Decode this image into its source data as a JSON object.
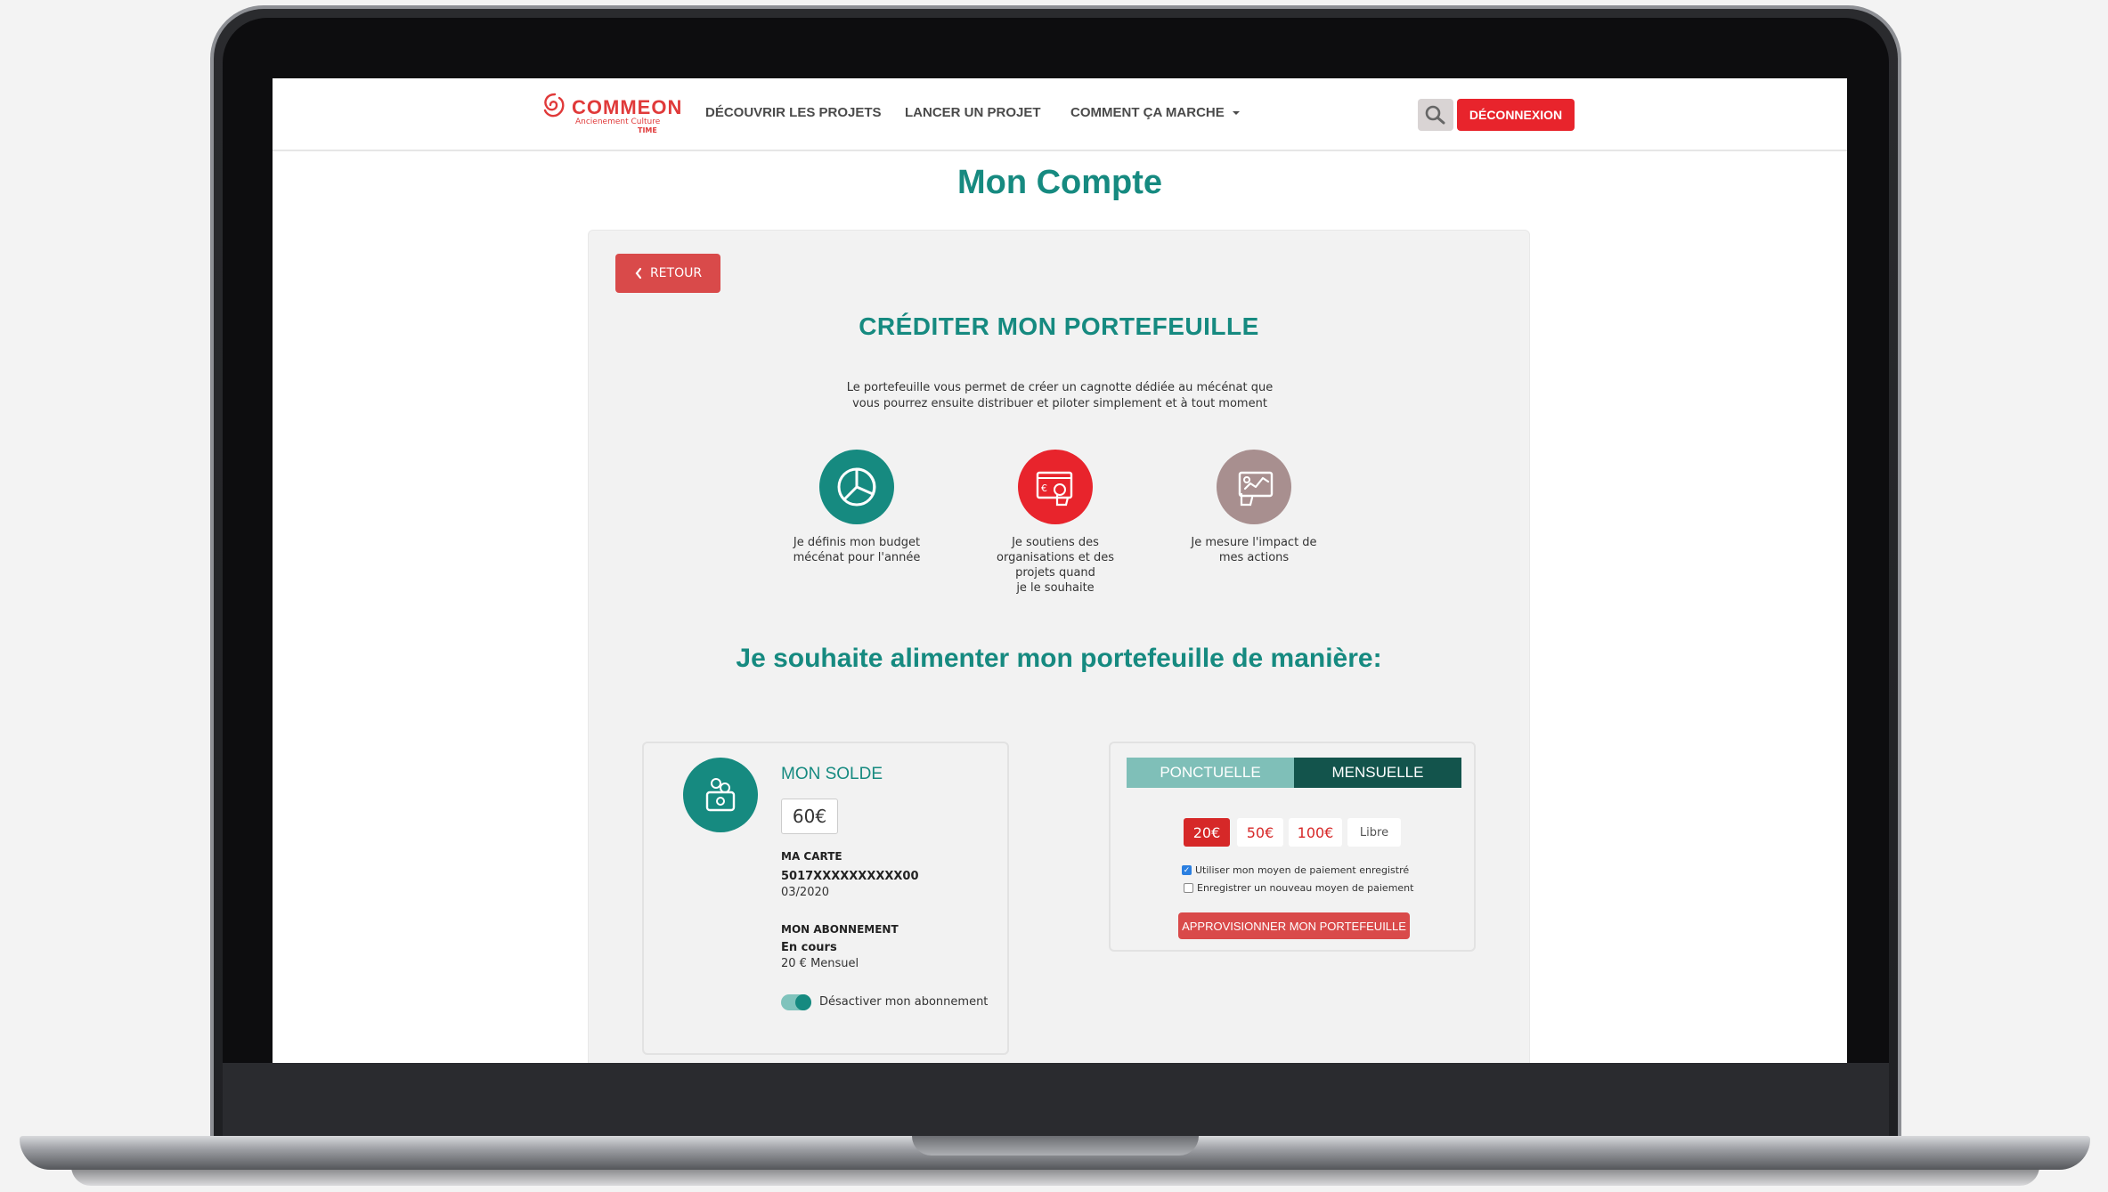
{
  "nav": {
    "logo_text": "COMMEON",
    "logo_sub": "Ancienement Culture",
    "logo_time": "TIME",
    "links": [
      "DÉCOUVRIR LES PROJETS",
      "LANCER UN PROJET",
      "COMMENT ÇA MARCHE"
    ],
    "logout_label": "DÉCONNEXION"
  },
  "page": {
    "title": "Mon Compte",
    "back_label": "RETOUR",
    "section_title": "CRÉDITER MON PORTEFEUILLE",
    "intro_line1": "Le portefeuille vous permet de créer un cagnotte dédiée au mécénat que",
    "intro_line2": "vous pourrez ensuite distribuer et piloter simplement et à tout moment",
    "subheading": "Je souhaite alimenter mon portefeuille de manière:"
  },
  "features": [
    {
      "label_lines": [
        "Je définis mon budget",
        "mécénat pour l'année"
      ],
      "color": "#168a80",
      "icon": "pie-chart-icon"
    },
    {
      "label_lines": [
        "Je soutiens des",
        "organisations et des",
        "projets quand",
        "je le souhaite"
      ],
      "color": "#e8242c",
      "icon": "screen-euro-icon"
    },
    {
      "label_lines": [
        "Je mesure l'impact de",
        "mes actions"
      ],
      "color": "#a88f8f",
      "icon": "chart-screen-icon"
    }
  ],
  "solde": {
    "title": "MON SOLDE",
    "amount": "60€",
    "card_label": "MA CARTE",
    "card_number": "5017XXXXXXXXXX00",
    "card_expiry": "03/2020",
    "subscription_label": "MON ABONNEMENT",
    "subscription_status": "En cours",
    "subscription_amount": "20 € Mensuel",
    "toggle_label": "Désactiver mon abonnement",
    "toggle_on": true
  },
  "payment": {
    "tab_oneoff": "PONCTUELLE",
    "tab_monthly": "MENSUELLE",
    "active_tab": "MENSUELLE",
    "amounts": [
      "20€",
      "50€",
      "100€",
      "Libre"
    ],
    "selected_amount": "20€",
    "option_saved": "Utiliser mon moyen de paiement enregistré",
    "option_saved_checked": true,
    "option_new": "Enregistrer un nouveau moyen de paiement",
    "option_new_checked": false,
    "submit_label": "APPROVISIONNER MON PORTEFEUILLE"
  },
  "colors": {
    "brand_teal": "#168a80",
    "brand_red": "#e8242c",
    "dark_teal": "#13544c"
  }
}
